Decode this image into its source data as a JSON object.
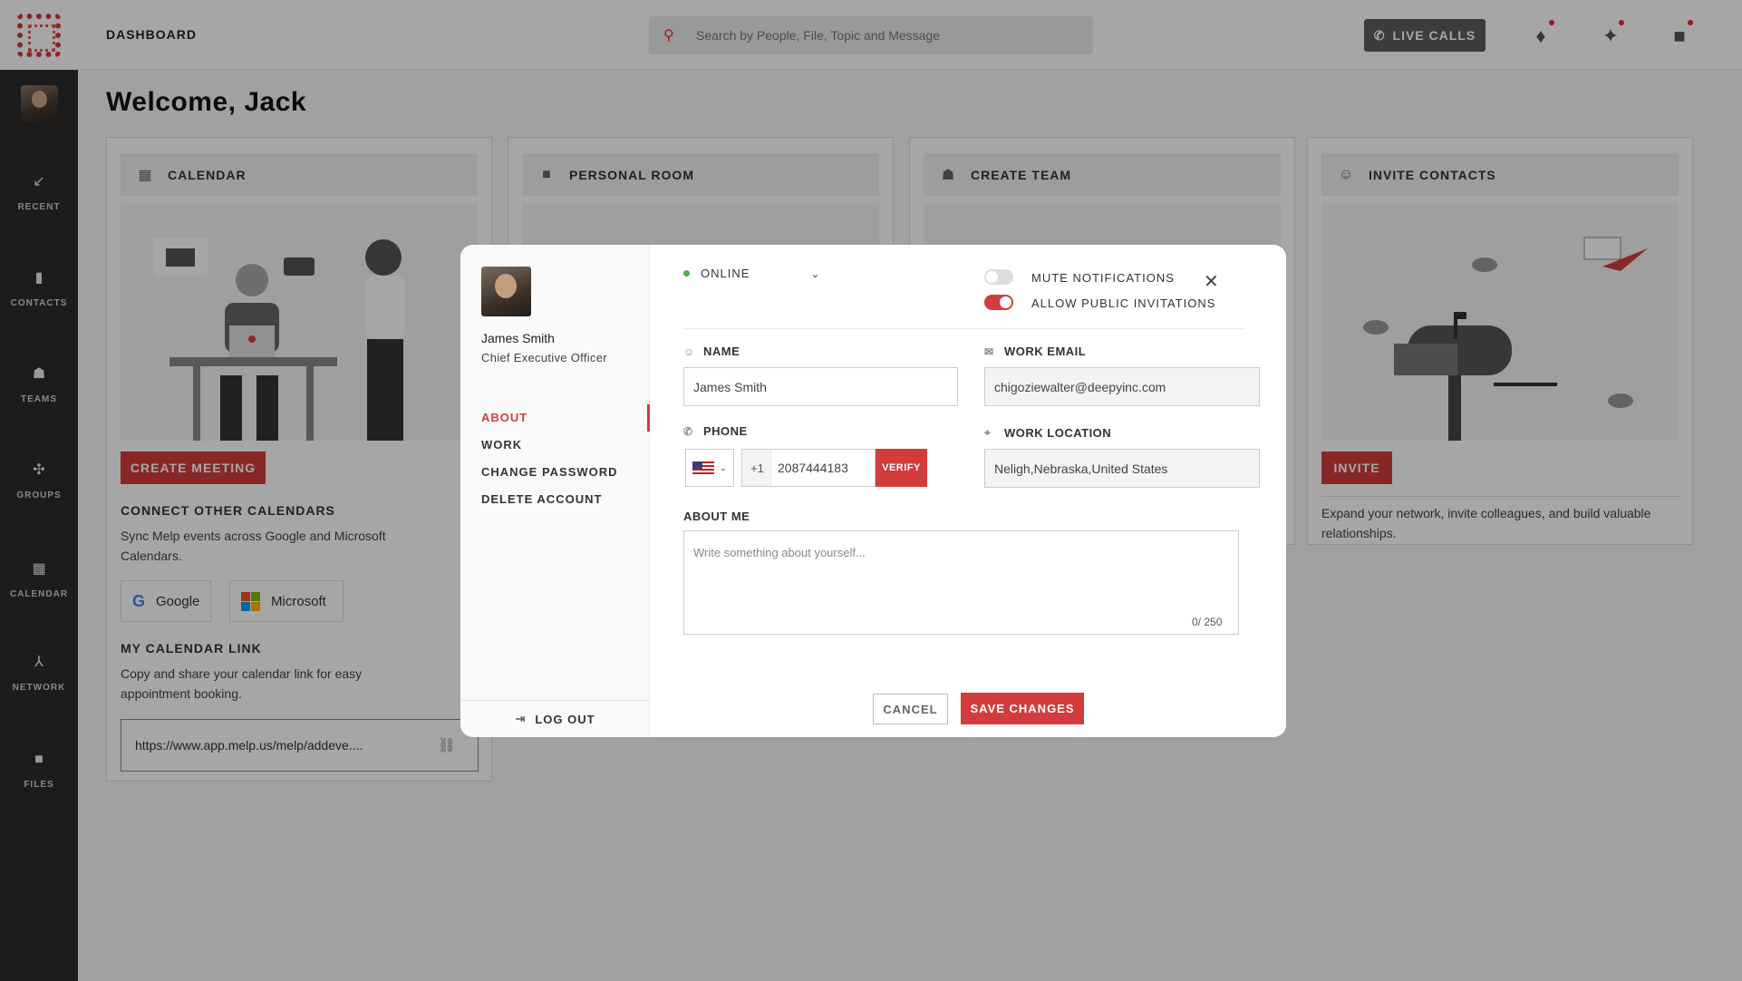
{
  "app": {
    "logo": "melp-logo"
  },
  "topbar": {
    "title": "DASHBOARD",
    "search_placeholder": "Search by People, File, Topic and Message",
    "live_calls": "LIVE CALLS"
  },
  "sidebar": {
    "items": [
      {
        "label": "RECENT",
        "icon": "recent-arrow-icon"
      },
      {
        "label": "CONTACTS",
        "icon": "contacts-book-icon"
      },
      {
        "label": "TEAMS",
        "icon": "teams-people-icon"
      },
      {
        "label": "GROUPS",
        "icon": "groups-icon"
      },
      {
        "label": "CALENDAR",
        "icon": "calendar-icon"
      },
      {
        "label": "NETWORK",
        "icon": "network-icon"
      },
      {
        "label": "FILES",
        "icon": "folder-icon"
      }
    ]
  },
  "main": {
    "welcome": "Welcome, Jack",
    "calendar": {
      "title": "CALENDAR",
      "create_meeting": "CREATE MEETING",
      "connect_title": "CONNECT OTHER CALENDARS",
      "connect_text": "Sync Melp events across Google and Microsoft Calendars.",
      "google": "Google",
      "microsoft": "Microsoft",
      "link_title": "MY CALENDAR LINK",
      "link_text": "Copy and share your calendar link for easy appointment booking.",
      "link_url": "https://www.app.melp.us/melp/addeve...."
    },
    "personal_room": {
      "title": "PERSONAL ROOM"
    },
    "create_team": {
      "title": "CREATE TEAM"
    },
    "invite_contacts": {
      "title": "INVITE CONTACTS",
      "invite": "INVITE",
      "text": "Expand your network, invite colleagues, and build valuable relationships."
    }
  },
  "modal": {
    "user_name": "James Smith",
    "user_role": "Chief Executive Officer",
    "nav": [
      "ABOUT",
      "WORK",
      "CHANGE PASSWORD",
      "DELETE ACCOUNT"
    ],
    "active_nav": "ABOUT",
    "logout": "LOG OUT",
    "status": "ONLINE",
    "status_color": "#4caf50",
    "mute_notifications": {
      "label": "MUTE NOTIFICATIONS",
      "on": false
    },
    "allow_invitations": {
      "label": "ALLOW PUBLIC INVITATIONS",
      "on": true
    },
    "name_label": "NAME",
    "name_value": "James Smith",
    "email_label": "WORK EMAIL",
    "email_value": "chigoziewalter@deepyinc.com",
    "phone_label": "PHONE",
    "phone_code": "+1",
    "phone_value": "2087444183",
    "verify": "VERIFY",
    "location_label": "WORK LOCATION",
    "location_value": "Neligh,Nebraska,United States",
    "about_label": "ABOUT ME",
    "about_placeholder": "Write something about yourself...",
    "about_counter": "0/ 250",
    "cancel": "CANCEL",
    "save": "SAVE CHANGES"
  },
  "colors": {
    "accent": "#d23c3c",
    "sidebar": "#2b2b2b"
  }
}
